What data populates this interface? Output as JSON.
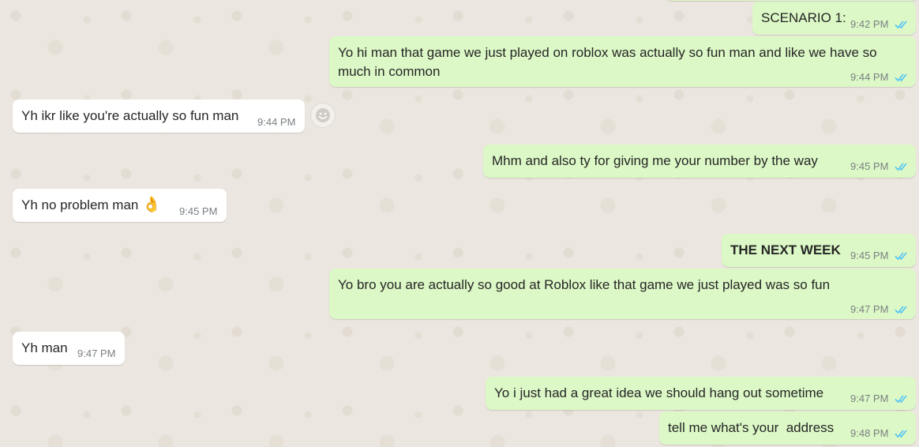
{
  "messages": [
    {
      "id": "m1",
      "direction": "outgoing",
      "text": "SCENARIO 1:",
      "time": "9:42 PM",
      "status": "read"
    },
    {
      "id": "m2",
      "direction": "outgoing",
      "text": "Yo hi man that game we just played on roblox was actually so fun man and like we have so much in common",
      "time": "9:44 PM",
      "status": "read"
    },
    {
      "id": "m3",
      "direction": "incoming",
      "text": "Yh ikr like you're actually so fun man",
      "time": "9:44 PM"
    },
    {
      "id": "m4",
      "direction": "outgoing",
      "text": "Mhm and also ty for giving me your number by the way",
      "time": "9:45 PM",
      "status": "read"
    },
    {
      "id": "m5",
      "direction": "incoming",
      "text": "Yh no problem man",
      "emoji": "👌",
      "time": "9:45 PM"
    },
    {
      "id": "m6",
      "direction": "outgoing",
      "text": "THE NEXT WEEK",
      "time": "9:45 PM",
      "status": "read"
    },
    {
      "id": "m7",
      "direction": "outgoing",
      "text": "Yo bro you are actually so good at Roblox like that game we just played was so fun",
      "time": "9:47 PM",
      "status": "read"
    },
    {
      "id": "m8",
      "direction": "incoming",
      "text": "Yh man",
      "time": "9:47 PM"
    },
    {
      "id": "m9",
      "direction": "outgoing",
      "text": "Yo i just had a great idea we should hang out sometime",
      "time": "9:47 PM",
      "status": "read"
    },
    {
      "id": "m10",
      "direction": "outgoing",
      "text": "tell me what's your  address",
      "time": "9:48 PM",
      "status": "read"
    }
  ],
  "colors": {
    "outgoing_bubble": "#dcf8c6",
    "incoming_bubble": "#ffffff",
    "read_ticks": "#4fc3f7",
    "timestamp": "#7a7f83"
  },
  "icons": {
    "read_receipt": "double-check-icon",
    "reaction": "smiley-icon"
  }
}
